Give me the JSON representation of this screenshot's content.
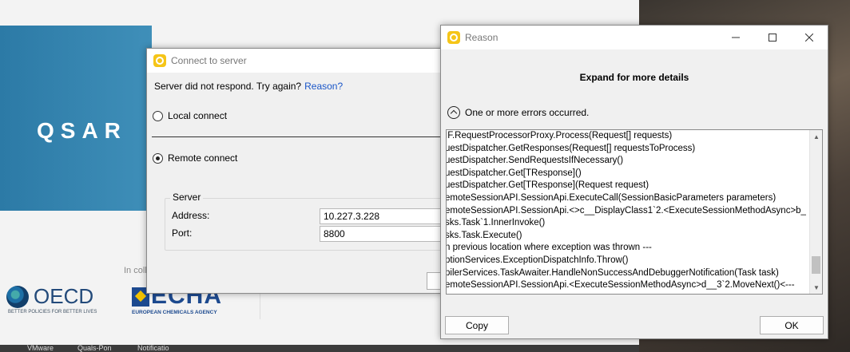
{
  "background": {
    "banner_text": "QSAR",
    "in_collaboration": "In coll",
    "oecd": {
      "name": "OECD",
      "tagline": "BETTER POLICIES FOR BETTER LIVES"
    },
    "echa": {
      "name": "ECHA",
      "tagline": "EUROPEAN CHEMICALS AGENCY"
    }
  },
  "taskbar": {
    "items": [
      "VMware",
      "Quals-Pon",
      "Notificatio"
    ]
  },
  "connect_dialog": {
    "title": "Connect to server",
    "message": "Server did not respond. Try again?",
    "reason_link": "Reason?",
    "local_connect_label": "Local connect",
    "local_connect_selected": false,
    "remote_connect_label": "Remote connect",
    "remote_connect_selected": true,
    "server_group_label": "Server",
    "address_label": "Address:",
    "address_value": "10.227.3.228",
    "port_label": "Port:",
    "port_value": "8800"
  },
  "reason_dialog": {
    "title": "Reason",
    "heading": "Expand for more details",
    "expander_label": "One or more errors occurred.",
    "details_lines": [
      "IF.RequestProcessorProxy.Process(Request[] requests)",
      "uestDispatcher.GetResponses(Request[] requestsToProcess)",
      "uestDispatcher.SendRequestsIfNecessary()",
      "uestDispatcher.Get[TResponse]()",
      "uestDispatcher.Get[TResponse](Request request)",
      "emoteSessionAPI.SessionApi.ExecuteCall(SessionBasicParameters parameters)",
      "emoteSessionAPI.SessionApi.<>c__DisplayClass1`2.<ExecuteSessionMethodAsync>b_",
      "sks.Task`1.InnerInvoke()",
      "sks.Task.Execute()",
      "n previous location where exception was thrown ---",
      "ptionServices.ExceptionDispatchInfo.Throw()",
      "pilerServices.TaskAwaiter.HandleNonSuccessAndDebuggerNotification(Task task)",
      "emoteSessionAPI.SessionApi.<ExecuteSessionMethodAsync>d__3`2.MoveNext()<---"
    ],
    "copy_button": "Copy",
    "ok_button": "OK"
  }
}
